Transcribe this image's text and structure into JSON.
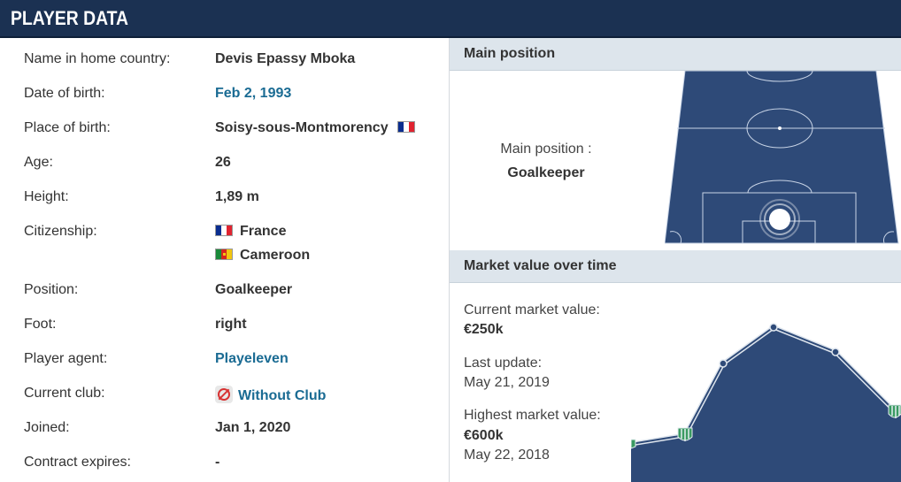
{
  "header": {
    "title": "PLAYER DATA"
  },
  "details": [
    {
      "label": "Name in home country:",
      "value": "Devis Epassy Mboka"
    },
    {
      "label": "Date of birth:",
      "value": "Feb 2, 1993"
    },
    {
      "label": "Place of birth:",
      "value": "Soisy-sous-Montmorency"
    },
    {
      "label": "Age:",
      "value": "26"
    },
    {
      "label": "Height:",
      "value": "1,89 m"
    },
    {
      "label": "Citizenship:",
      "value": "France",
      "value2": "Cameroon"
    },
    {
      "label": "Position:",
      "value": "Goalkeeper"
    },
    {
      "label": "Foot:",
      "value": "right"
    },
    {
      "label": "Player agent:",
      "value": "Playeleven"
    },
    {
      "label": "Current club:",
      "value": "Without Club"
    },
    {
      "label": "Joined:",
      "value": "Jan 1, 2020"
    },
    {
      "label": "Contract expires:",
      "value": "-"
    }
  ],
  "main_position": {
    "title": "Main position",
    "label": "Main position :",
    "value": "Goalkeeper"
  },
  "market_value": {
    "title": "Market value over time",
    "current_label": "Current market value:",
    "current_value": "€250k",
    "last_update_label": "Last update:",
    "last_update_value": "May 21, 2019",
    "highest_label": "Highest market value:",
    "highest_value": "€600k",
    "highest_date": "May 22, 2018"
  },
  "colors": {
    "header_bg": "#1b3152",
    "link": "#1a6b93",
    "pitch": "#2e4a78",
    "chart_fill": "#2e4a78"
  }
}
